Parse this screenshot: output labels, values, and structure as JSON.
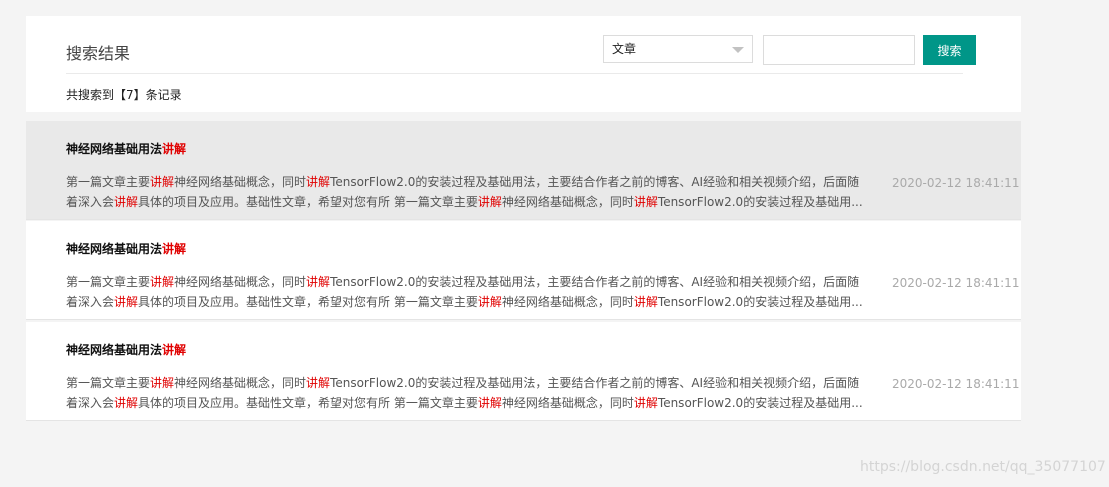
{
  "header": {
    "title": "搜索结果",
    "select_value": "文章",
    "search_value": "",
    "search_button": "搜索",
    "count_text": "共搜索到【7】条记录"
  },
  "results": [
    {
      "title": "神经网络基础用法",
      "title_hl": "讲解",
      "desc_parts": [
        "第一篇文章主要",
        "讲解",
        "神经网络基础概念，同时",
        "讲解",
        "TensorFlow2.0的安装过程及基础用法，主要结合作者之前的博客、AI经验和相关视频介绍，后面随着深入会",
        "讲解",
        "具体的项目及应用。基础性文章，希望对您有所 第一篇文章主要",
        "讲解",
        "神经网络基础概念，同时",
        "讲解",
        "TensorFlow2.0的安装过程及基础用..."
      ],
      "date": "2020-02-12 18:41:11"
    },
    {
      "title": "神经网络基础用法",
      "title_hl": "讲解",
      "desc_parts": [
        "第一篇文章主要",
        "讲解",
        "神经网络基础概念，同时",
        "讲解",
        "TensorFlow2.0的安装过程及基础用法，主要结合作者之前的博客、AI经验和相关视频介绍，后面随着深入会",
        "讲解",
        "具体的项目及应用。基础性文章，希望对您有所 第一篇文章主要",
        "讲解",
        "神经网络基础概念，同时",
        "讲解",
        "TensorFlow2.0的安装过程及基础用..."
      ],
      "date": "2020-02-12 18:41:11"
    },
    {
      "title": "神经网络基础用法",
      "title_hl": "讲解",
      "desc_parts": [
        "第一篇文章主要",
        "讲解",
        "神经网络基础概念，同时",
        "讲解",
        "TensorFlow2.0的安装过程及基础用法，主要结合作者之前的博客、AI经验和相关视频介绍，后面随着深入会",
        "讲解",
        "具体的项目及应用。基础性文章，希望对您有所 第一篇文章主要",
        "讲解",
        "神经网络基础概念，同时",
        "讲解",
        "TensorFlow2.0的安装过程及基础用..."
      ],
      "date": "2020-02-12 18:41:11"
    }
  ],
  "watermark": "https://blog.csdn.net/qq_35077107",
  "colors": {
    "accent": "#009688",
    "highlight": "#e00000",
    "hover_row": "#e9e9e9"
  }
}
